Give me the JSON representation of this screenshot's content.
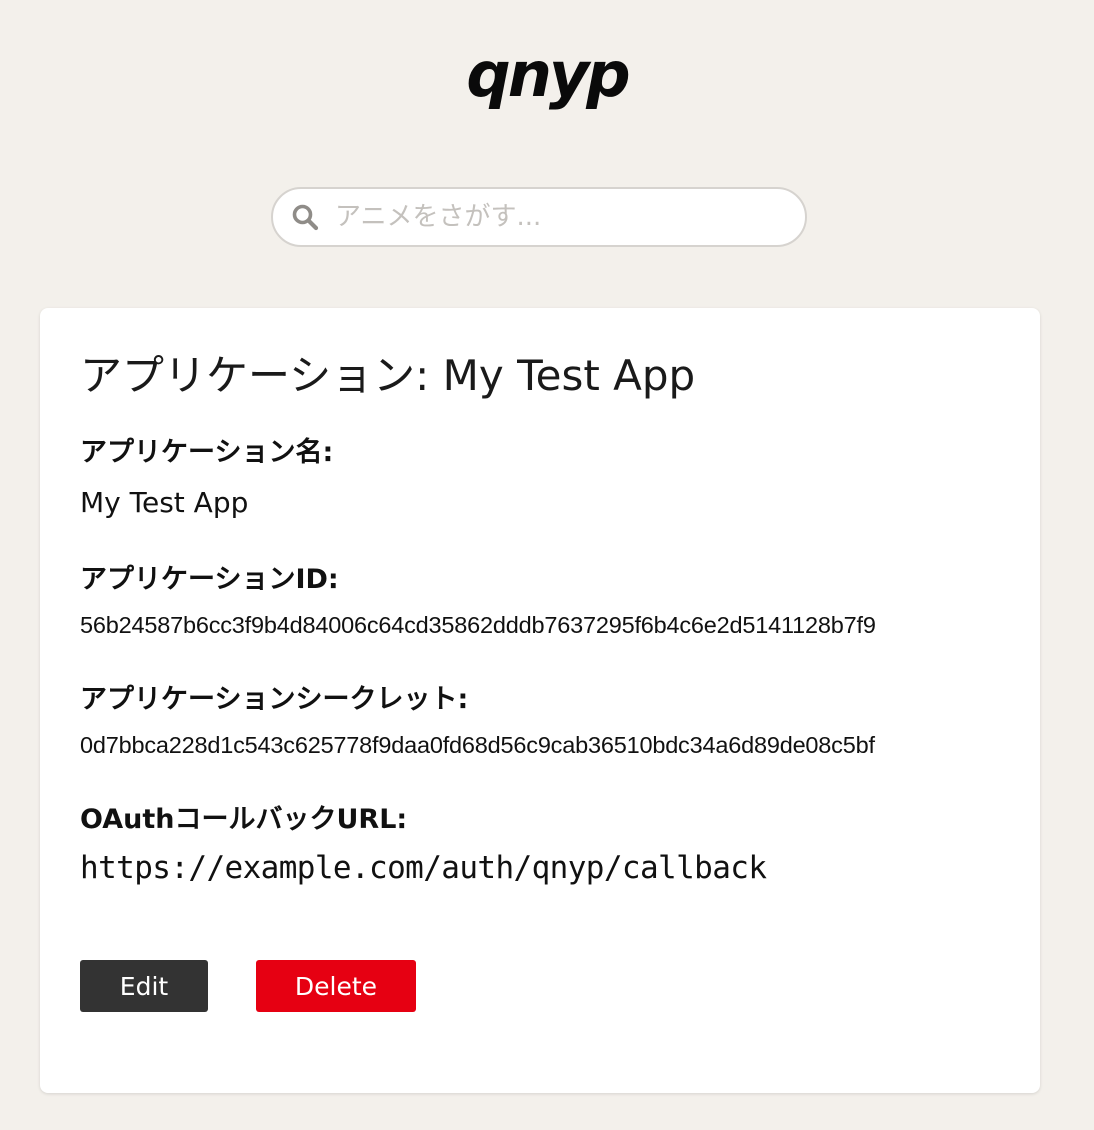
{
  "header": {
    "logo_text": "qnyp"
  },
  "search": {
    "placeholder": "アニメをさがす..."
  },
  "app": {
    "title": "アプリケーション: My Test App",
    "fields": {
      "name_label": "アプリケーション名:",
      "name_value": "My Test App",
      "id_label": "アプリケーションID:",
      "id_value": "56b24587b6cc3f9b4d84006c64cd35862dddb7637295f6b4c6e2d5141128b7f9",
      "secret_label": "アプリケーションシークレット:",
      "secret_value": "0d7bbca228d1c543c625778f9daa0fd68d56c9cab36510bdc34a6d89de08c5bf",
      "callback_label": "OAuthコールバックURL:",
      "callback_value": "https://example.com/auth/qnyp/callback"
    },
    "actions": {
      "edit_label": "Edit",
      "delete_label": "Delete"
    }
  },
  "colors": {
    "page_background": "#f3f0eb",
    "edit_button": "#333333",
    "delete_button": "#e60012"
  },
  "icons": {
    "search": "search-icon"
  }
}
